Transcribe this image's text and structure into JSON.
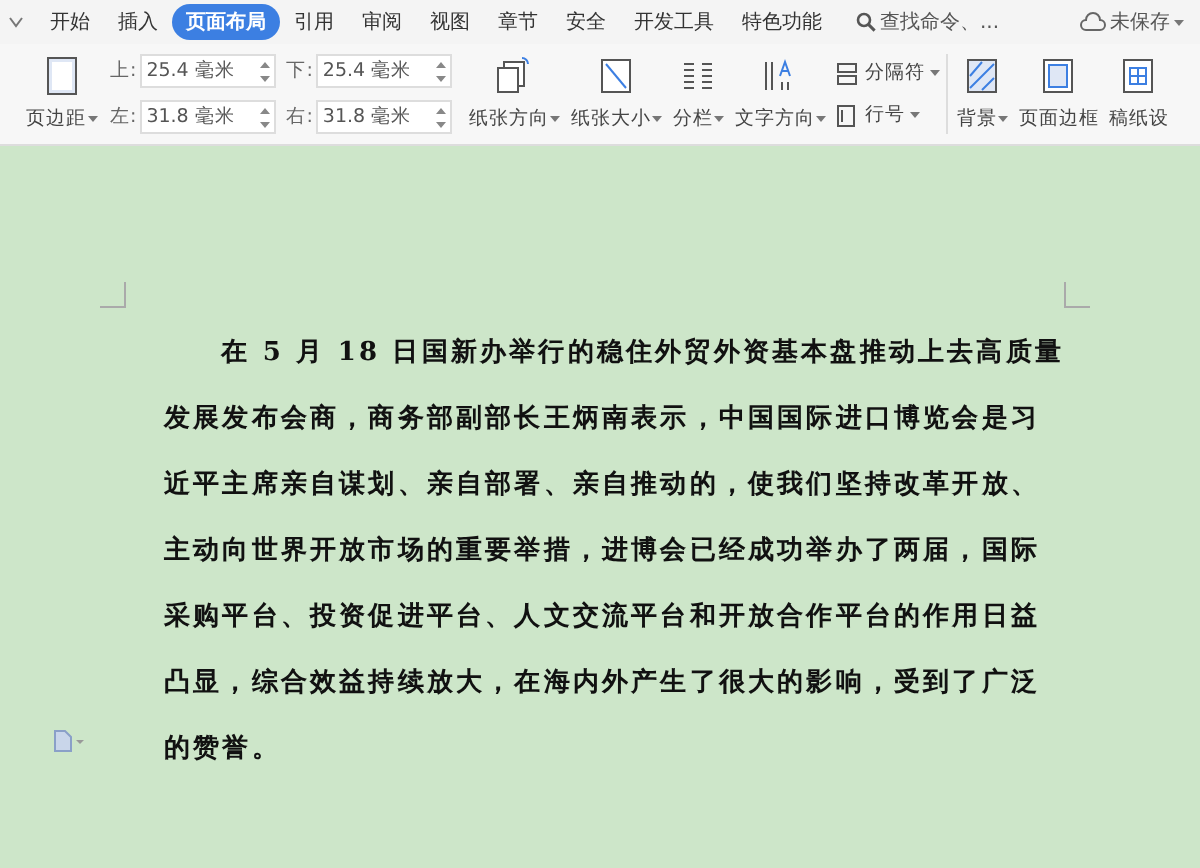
{
  "menu_tabs": [
    {
      "label": "开始",
      "selected": false
    },
    {
      "label": "插入",
      "selected": false
    },
    {
      "label": "页面布局",
      "selected": true
    },
    {
      "label": "引用",
      "selected": false
    },
    {
      "label": "审阅",
      "selected": false
    },
    {
      "label": "视图",
      "selected": false
    },
    {
      "label": "章节",
      "selected": false
    },
    {
      "label": "安全",
      "selected": false
    },
    {
      "label": "开发工具",
      "selected": false
    },
    {
      "label": "特色功能",
      "selected": false
    }
  ],
  "search": {
    "placeholder": "查找命令、..."
  },
  "save_status": "未保存",
  "ribbon": {
    "margins_button": "页边距",
    "margins": [
      {
        "label": "上:",
        "value": "25.4 毫米"
      },
      {
        "label": "下:",
        "value": "25.4 毫米"
      },
      {
        "label": "左:",
        "value": "31.8 毫米"
      },
      {
        "label": "右:",
        "value": "31.8 毫米"
      }
    ],
    "buttons": [
      {
        "label": "纸张方向",
        "kind": "large",
        "dropdown": true
      },
      {
        "label": "纸张大小",
        "kind": "large",
        "dropdown": true
      },
      {
        "label": "分栏",
        "kind": "large",
        "dropdown": true
      },
      {
        "label": "文字方向",
        "kind": "large",
        "dropdown": true
      },
      {
        "label": "分隔符",
        "kind": "small",
        "dropdown": true
      },
      {
        "label": "行号",
        "kind": "small",
        "dropdown": true
      },
      {
        "label": "背景",
        "kind": "large",
        "dropdown": true
      },
      {
        "label": "页面边框",
        "kind": "large",
        "dropdown": false
      },
      {
        "label": "稿纸设",
        "kind": "large",
        "dropdown": false
      }
    ]
  },
  "document": {
    "paragraph": "在 5 月 18 日国新办举行的稳住外贸外资基本盘推动上去高质量发展发布会商，商务部副部长王炳南表示，中国国际进口博览会是习近平主席亲自谋划、亲自部署、亲自推动的，使我们坚持改革开放、主动向世界开放市场的重要举措，进博会已经成功举办了两届，国际采购平台、投资促进平台、人文交流平台和开放合作平台的作用日益凸显，综合效益持续放大，在海内外产生了很大的影响，受到了广泛的赞誉。"
  }
}
